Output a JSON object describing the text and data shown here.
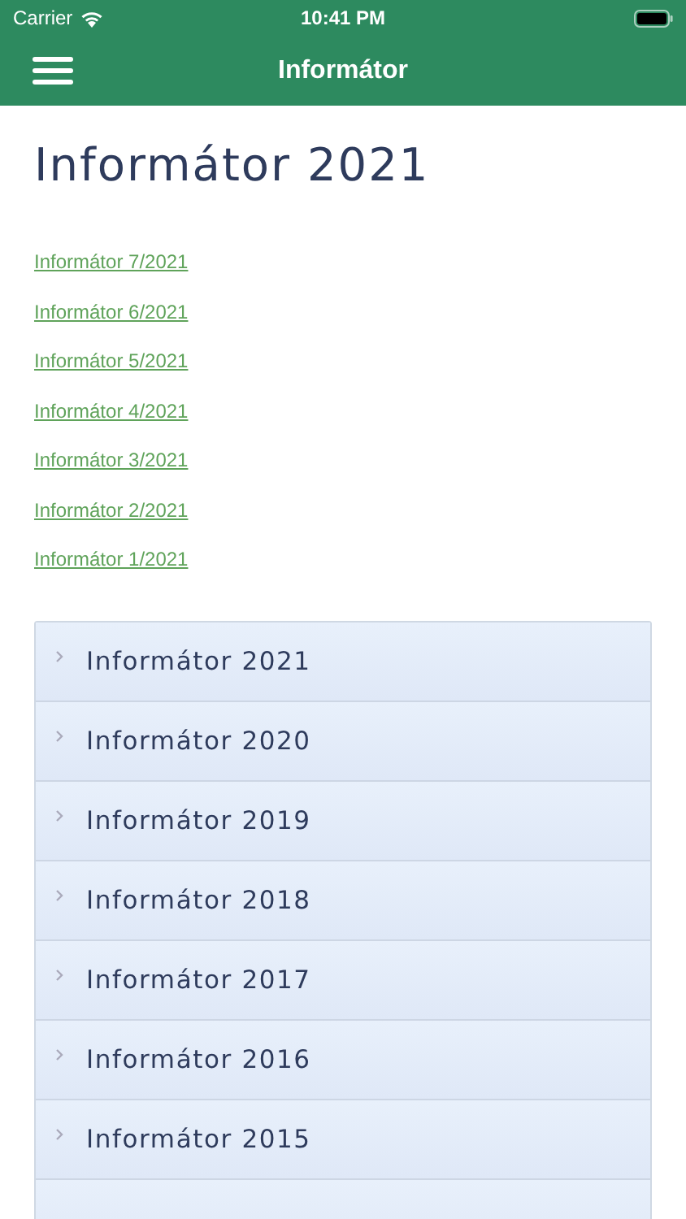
{
  "status_bar": {
    "carrier": "Carrier",
    "time": "10:41 PM"
  },
  "nav_bar": {
    "title": "Informátor"
  },
  "heading": "Informátor 2021",
  "links": [
    "Informátor 7/2021",
    "Informátor 6/2021",
    "Informátor 5/2021",
    "Informátor 4/2021",
    "Informátor 3/2021",
    "Informátor 2/2021",
    "Informátor 1/2021"
  ],
  "accordion": [
    {
      "label": "Informátor 2021",
      "expanded": false
    },
    {
      "label": "Informátor 2020",
      "expanded": false
    },
    {
      "label": "Informátor 2019",
      "expanded": false
    },
    {
      "label": "Informátor 2018",
      "expanded": false
    },
    {
      "label": "Informátor 2017",
      "expanded": false
    },
    {
      "label": "Informátor 2016",
      "expanded": false
    },
    {
      "label": "Informátor 2015",
      "expanded": false
    }
  ]
}
